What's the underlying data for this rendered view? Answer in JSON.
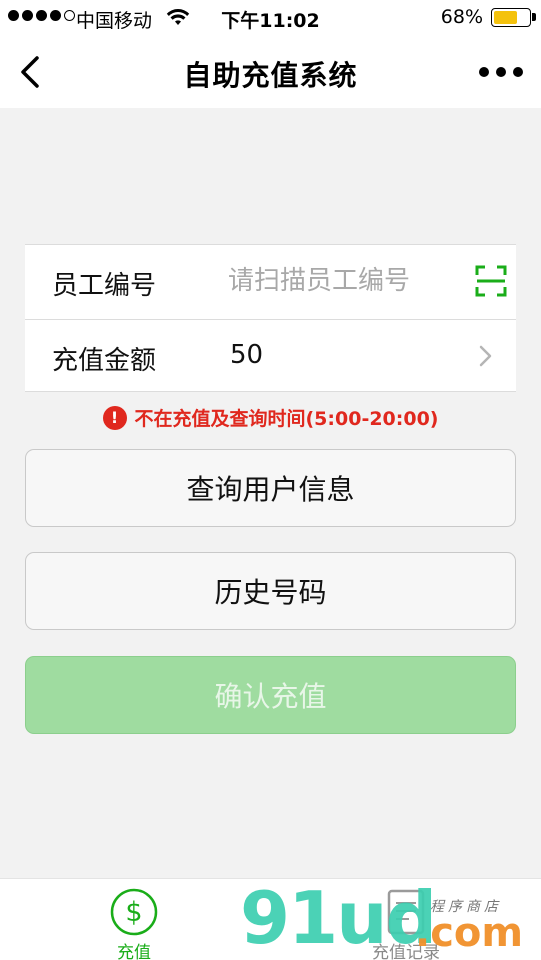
{
  "status_bar": {
    "carrier": "中国移动",
    "time": "下午11:02",
    "battery_percent": "68%",
    "battery_level": 0.68,
    "battery_color": "#f4c20d"
  },
  "nav": {
    "title": "自助充值系统",
    "back_icon": "chevron-left-icon",
    "more_icon": "more-dots-icon"
  },
  "form": {
    "employee": {
      "label": "员工编号",
      "placeholder": "请扫描员工编号",
      "value": "",
      "icon": "scan-icon"
    },
    "amount": {
      "label": "充值金额",
      "value": "50",
      "icon": "chevron-right-icon"
    }
  },
  "warning": {
    "icon": "!",
    "text": "不在充值及查询时间(5:00-20:00)",
    "color": "#e0281e"
  },
  "buttons": {
    "query": "查询用户信息",
    "history": "历史号码",
    "confirm": "确认充值"
  },
  "tabbar": {
    "recharge": {
      "label": "充值",
      "icon": "dollar-circle-icon",
      "active_color": "#1aad19"
    },
    "records": {
      "label": "充值记录",
      "icon": "document-icon"
    }
  },
  "watermark": {
    "brand": "91ud",
    "suffix": ".com",
    "shop": "程序商店"
  }
}
